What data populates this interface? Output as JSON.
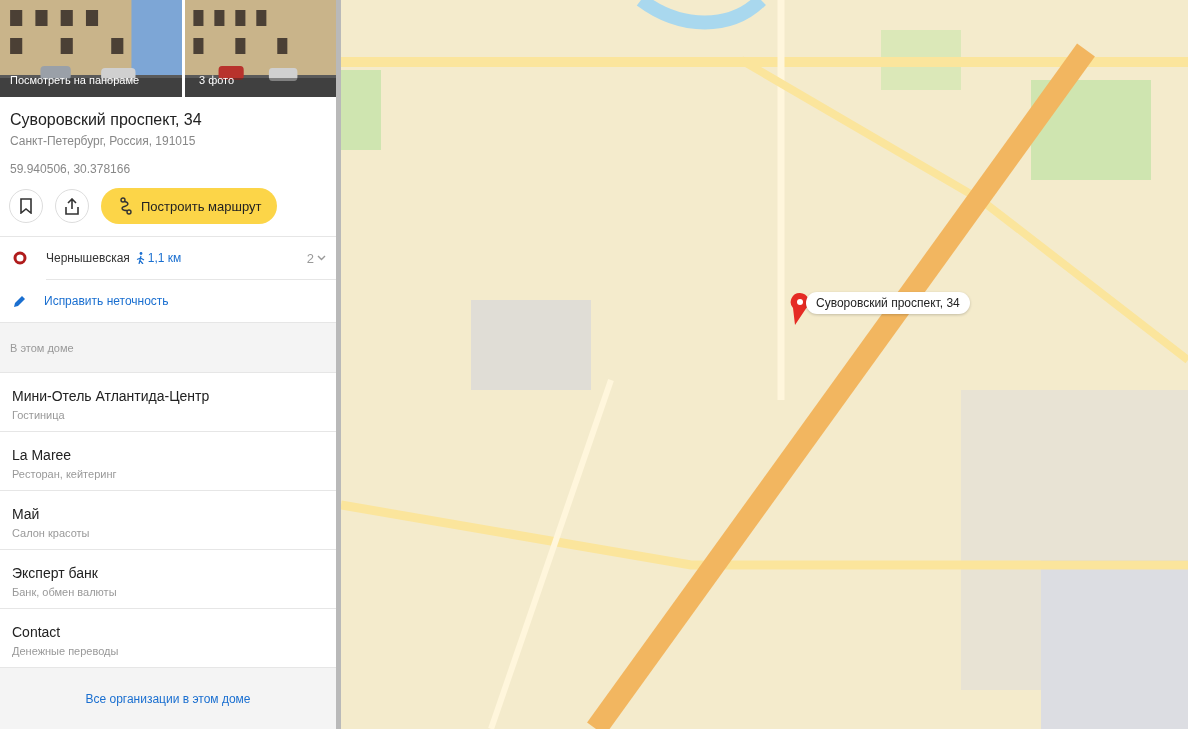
{
  "photos": [
    {
      "caption": "Посмотреть на панораме"
    },
    {
      "caption": "3 фото"
    }
  ],
  "place": {
    "title": "Суворовский проспект, 34",
    "address": "Санкт-Петербург, Россия, 191015",
    "coordinates": "59.940506, 30.378166"
  },
  "actions": {
    "route_button": "Построить маршрут"
  },
  "metro": {
    "station": "Чернышевская",
    "distance": "1,1 км",
    "count": "2"
  },
  "fix_link": "Исправить неточность",
  "section_title": "В этом доме",
  "organizations": [
    {
      "name": "Мини-Отель Атлантида-Центр",
      "category": "Гостиница"
    },
    {
      "name": "La Maree",
      "category": "Ресторан, кейтеринг"
    },
    {
      "name": "Май",
      "category": "Салон красоты"
    },
    {
      "name": "Эксперт банк",
      "category": "Банк, обмен валюты"
    },
    {
      "name": "Contact",
      "category": "Денежные переводы"
    }
  ],
  "all_link": "Все организации в этом доме",
  "map": {
    "marker_label": "Суворовский проспект, 34"
  }
}
